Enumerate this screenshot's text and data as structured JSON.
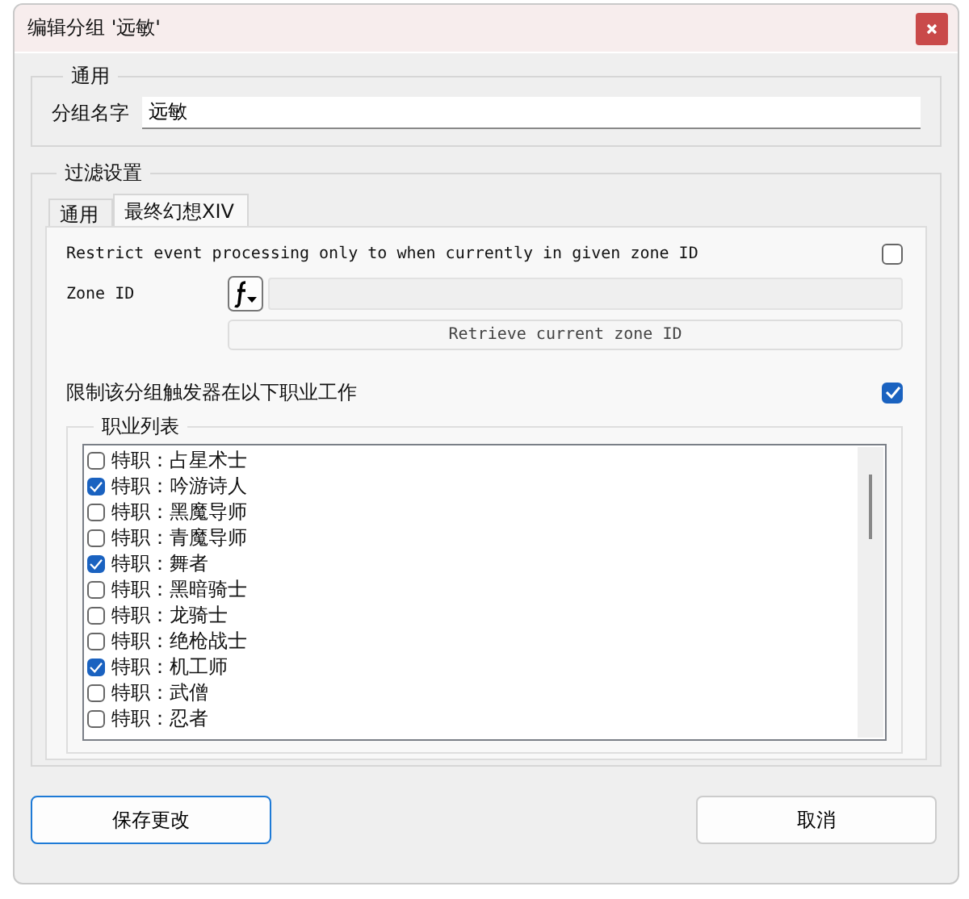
{
  "window": {
    "title": "编辑分组 '远敏'"
  },
  "general": {
    "legend": "通用",
    "name_label": "分组名字",
    "name_value": "远敏"
  },
  "filter": {
    "legend": "过滤设置",
    "tabs": [
      {
        "label": "通用",
        "selected": false
      },
      {
        "label": "最终幻想XIV",
        "selected": true
      }
    ],
    "restrict_zone": {
      "label": "Restrict event processing only to when currently in given zone ID",
      "checked": false
    },
    "zone_id": {
      "label": "Zone ID"
    },
    "retrieve_button": "Retrieve current zone ID",
    "restrict_jobs": {
      "label": "限制该分组触发器在以下职业工作",
      "checked": true
    },
    "job_list": {
      "legend": "职业列表",
      "items": [
        {
          "label": "特职：占星术士",
          "checked": false
        },
        {
          "label": "特职：吟游诗人",
          "checked": true
        },
        {
          "label": "特职：黑魔导师",
          "checked": false
        },
        {
          "label": "特职：青魔导师",
          "checked": false
        },
        {
          "label": "特职：舞者",
          "checked": true
        },
        {
          "label": "特职：黑暗骑士",
          "checked": false
        },
        {
          "label": "特职：龙骑士",
          "checked": false
        },
        {
          "label": "特职：绝枪战士",
          "checked": false
        },
        {
          "label": "特职：机工师",
          "checked": true
        },
        {
          "label": "特职：武僧",
          "checked": false
        },
        {
          "label": "特职：忍者",
          "checked": false
        }
      ]
    }
  },
  "buttons": [
    {
      "label": "保存更改",
      "kind": "primary"
    },
    {
      "label": "取消",
      "kind": "default"
    }
  ]
}
